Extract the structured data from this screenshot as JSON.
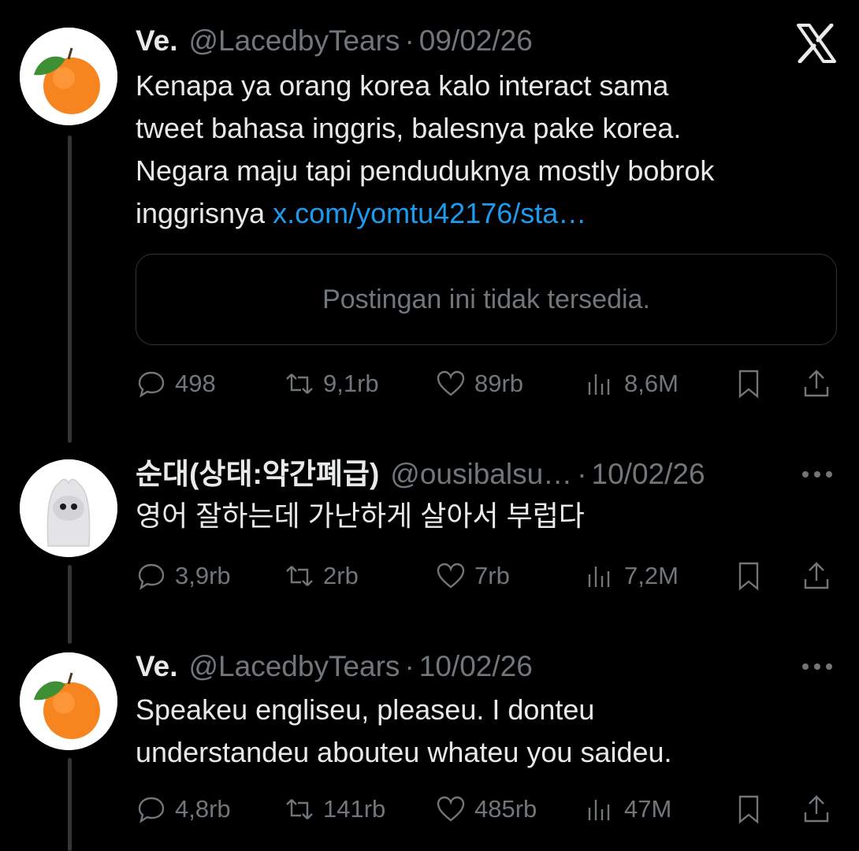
{
  "posts": [
    {
      "name": "Ve.",
      "handle": "@LacedbyTears",
      "date": "09/02/26",
      "lines": [
        "Kenapa ya orang korea kalo interact sama",
        "tweet bahasa inggris, balesnya pake korea.",
        "Negara maju tapi penduduknya mostly bobrok"
      ],
      "last_line": "inggrisnya",
      "link": "x.com/yomtu42176/sta…",
      "quote_unavailable": "Postingan ini tidak tersedia.",
      "stats": {
        "replies": "498",
        "reposts": "9,1rb",
        "likes": "89rb",
        "views": "8,6M"
      }
    },
    {
      "name": "순대(상태:약간폐급)",
      "handle": "@ousibalsu…",
      "date": "10/02/26",
      "lines": [
        "영어 잘하는데 가난하게 살아서 부럽다"
      ],
      "stats": {
        "replies": "3,9rb",
        "reposts": "2rb",
        "likes": "7rb",
        "views": "7,2M"
      }
    },
    {
      "name": "Ve.",
      "handle": "@LacedbyTears",
      "date": "10/02/26",
      "lines": [
        "Speakeu engliseu, pleaseu. I donteu",
        "understandeu abouteu whateu you saideu."
      ],
      "stats": {
        "replies": "4,8rb",
        "reposts": "141rb",
        "likes": "485rb",
        "views": "47M"
      }
    }
  ],
  "icons": {
    "brand": "x-logo-icon",
    "reply": "reply-icon",
    "repost": "repost-icon",
    "like": "heart-icon",
    "views": "views-icon",
    "bookmark": "bookmark-icon",
    "share": "share-icon",
    "more": "more-icon"
  },
  "colors": {
    "background": "#000000",
    "text": "#e7e9ea",
    "muted": "#71767b",
    "link": "#1d9bf0"
  }
}
